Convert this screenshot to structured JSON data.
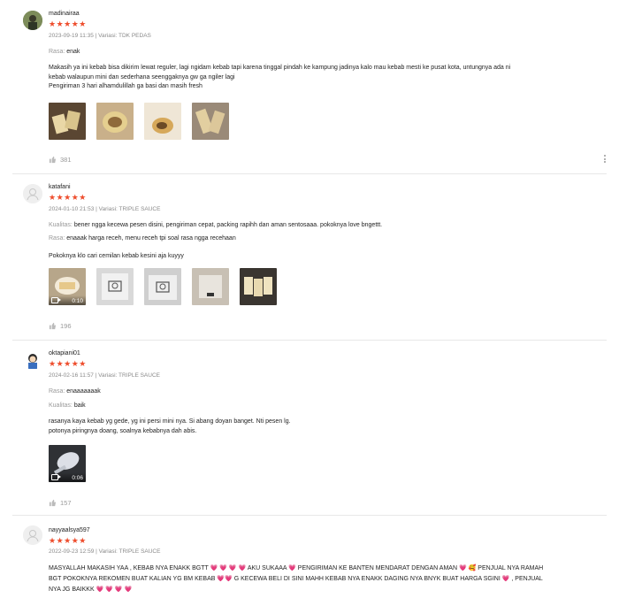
{
  "reviews": [
    {
      "username": "madinairaa",
      "stars": "★★★★★",
      "meta": "2023-09-19 11:35 | Variasi: TDK PEDAS",
      "fields": [
        {
          "key": "Rasa:",
          "value": "enak"
        }
      ],
      "body": "Makasih ya ini kebab bisa dikirim lewat reguler, lagi ngidam kebab tapi karena tinggal  pindah ke kampung jadinya kalo mau kebab mesti ke pusat kota, untungnya ada ni\nkebab walaupun mini dan sederhana seenggaknya gw ga ngiler lagi\nPengiriman 3 hari alhamdulillah ga basi dan masih fresh",
      "media": [
        {
          "kind": "image",
          "icon": "kebab-photo"
        },
        {
          "kind": "image",
          "icon": "kebab-photo"
        },
        {
          "kind": "image",
          "icon": "kebab-photo"
        },
        {
          "kind": "image",
          "icon": "kebab-photo"
        }
      ],
      "likes": "381"
    },
    {
      "username": "katafani",
      "stars": "★★★★★",
      "meta": "2024-01-10 21:53 | Variasi: TRIPLE SAUCE",
      "fields": [
        {
          "key": "Kualitas:",
          "value": "bener ngga kecewa pesen disini, pengiriman cepat, packing rapihh dan aman sentosaaa. pokoknya love bngettt."
        },
        {
          "key": "Rasa:",
          "value": "enaaak harga receh, menu receh tpi soal rasa ngga recehaan"
        }
      ],
      "body": "Pokoknya klo cari cemilan kebab kesini aja kuyyy",
      "media": [
        {
          "kind": "video",
          "duration": "0:10"
        },
        {
          "kind": "image",
          "icon": "package-photo"
        },
        {
          "kind": "image",
          "icon": "package-photo"
        },
        {
          "kind": "image",
          "icon": "package-photo"
        },
        {
          "kind": "image",
          "icon": "kebab-photo"
        }
      ],
      "likes": "196"
    },
    {
      "username": "oktapiani01",
      "stars": "★★★★★",
      "meta": "2024-02-16 11:57 | Variasi: TRIPLE SAUCE",
      "fields": [
        {
          "key": "Rasa:",
          "value": "enaaaaaaak"
        },
        {
          "key": "Kualitas:",
          "value": "baik"
        }
      ],
      "body": "rasanya kaya kebab yg gede, yg ini persi mini nya. Si abang doyan banget. Nti pesen lg.\npotonya piringnya doang, soalnya kebabnya dah abis.",
      "media": [
        {
          "kind": "video",
          "duration": "0:06"
        }
      ],
      "likes": "157"
    },
    {
      "username": "nayyaalsya597",
      "stars": "★★★★★",
      "meta": "2022-09-23 12:59 | Variasi: TRIPLE SAUCE",
      "body": "MASYALLAH MAKASIH YAA , KEBAB NYA ENAKK BGTT 💗 💗 💗 💗  AKU SUKAAA  💗  PENGIRIMAN KE BANTEN MENDARAT DENGAN AMAN 💗 🥰 PENJUAL NYA RAMAH\nBGT POKOKNYA REKOMEN BUAT KALIAN YG BM KEBAB 💗💗  G KECEWA BELI DI SINI MAHH KEBAB NYA ENAKK DAGING NYA BNYK BUAT HARGA SGINI 💗  , PENJUAL\nNYA JG BAIKKK 💗 💗 💗 💗"
    }
  ]
}
